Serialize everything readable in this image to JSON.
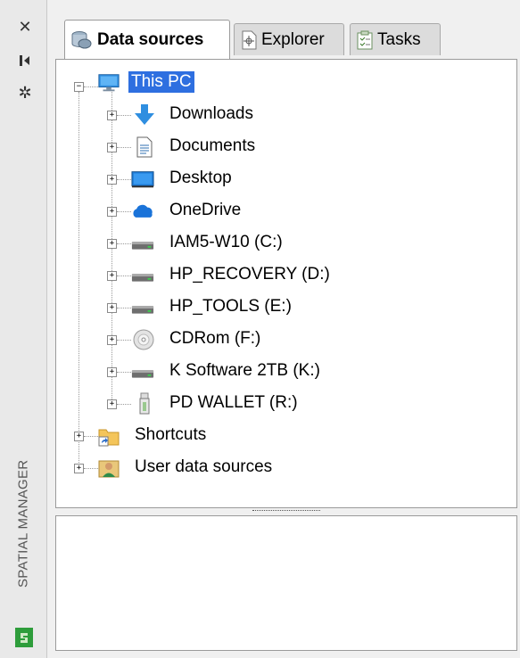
{
  "sidebar": {
    "title": "SPATIAL MANAGER",
    "buttons": [
      {
        "icon": "close-icon",
        "glyph": "✕"
      },
      {
        "icon": "pin-icon",
        "glyph": "⇥"
      },
      {
        "icon": "gear-icon",
        "glyph": "✲"
      }
    ]
  },
  "tabs": [
    {
      "label": "Data sources",
      "icon": "database-icon",
      "active": true
    },
    {
      "label": "Explorer",
      "icon": "explorer-icon",
      "active": false
    },
    {
      "label": "Tasks",
      "icon": "tasks-icon",
      "active": false
    }
  ],
  "tree": {
    "root": {
      "label": "This PC",
      "icon": "computer-icon",
      "expanded": true,
      "selected": true
    },
    "children": [
      {
        "label": "Downloads",
        "icon": "download-arrow-icon"
      },
      {
        "label": "Documents",
        "icon": "document-icon"
      },
      {
        "label": "Desktop",
        "icon": "desktop-icon"
      },
      {
        "label": "OneDrive",
        "icon": "cloud-icon"
      },
      {
        "label": "IAM5-W10 (C:)",
        "icon": "drive-icon"
      },
      {
        "label": "HP_RECOVERY (D:)",
        "icon": "drive-icon"
      },
      {
        "label": "HP_TOOLS (E:)",
        "icon": "drive-icon"
      },
      {
        "label": "CDRom (F:)",
        "icon": "cd-icon"
      },
      {
        "label": "K Software 2TB (K:)",
        "icon": "drive-icon"
      },
      {
        "label": "PD WALLET (R:)",
        "icon": "usb-drive-icon"
      }
    ],
    "siblings": [
      {
        "label": "Shortcuts",
        "icon": "shortcut-folder-icon"
      },
      {
        "label": "User data sources",
        "icon": "user-icon"
      }
    ]
  },
  "colors": {
    "selection": "#2e6fe0",
    "brand_green": "#2e9d3b"
  }
}
